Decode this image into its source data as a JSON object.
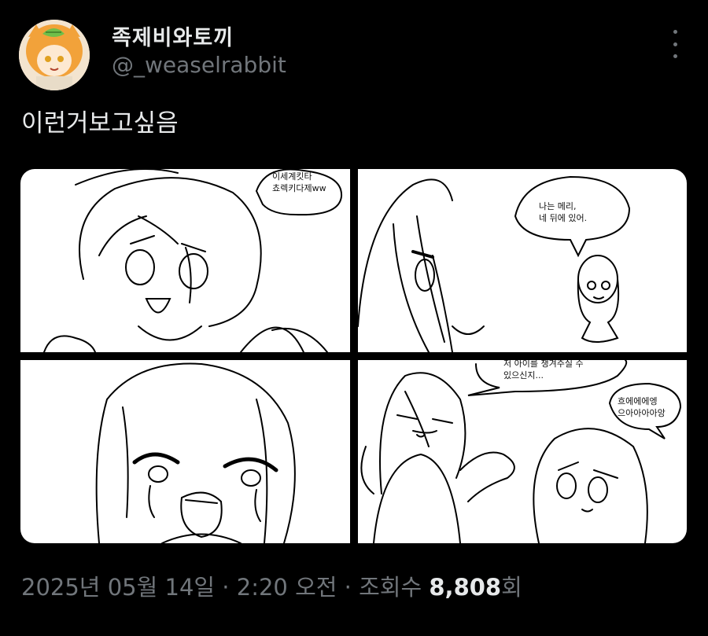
{
  "author": {
    "display_name": "족제비와토끼",
    "handle": "@_weaselrabbit"
  },
  "tweet": {
    "text": "이런거보고싶음"
  },
  "comic": {
    "panel1_bubble": "이세계킷타\n쵸렉키다제ww",
    "panel2_bubble": "나는 메리,\n네 뒤에 있어.",
    "panel4_bubble_top": "저 아이를 챙겨주실 수\n있으신지...",
    "panel4_bubble_right": "흐에에에엥\n으아아아아앙"
  },
  "meta": {
    "date": "2025년 05월 14일",
    "separator1": " · ",
    "time": "2:20 오전",
    "separator2": " · ",
    "views_label": "조회수 ",
    "views_count": "8,808",
    "views_suffix": "회"
  },
  "icons": {
    "more": "more-vertical-icon"
  }
}
